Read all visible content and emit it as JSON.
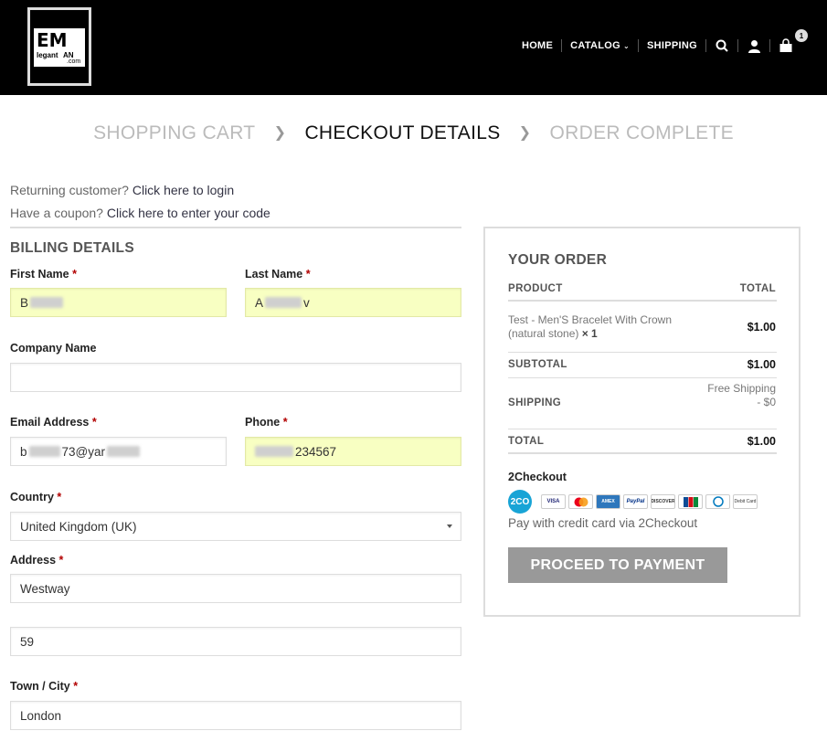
{
  "header": {
    "logo": {
      "big": "EM",
      "small_left": "legant",
      "small_right": "AN",
      "small_sub": ".com"
    },
    "nav": [
      {
        "label": "HOME"
      },
      {
        "label": "CATALOG"
      },
      {
        "label": "SHIPPING"
      }
    ],
    "cart_count": "1"
  },
  "steps": {
    "cart": "SHOPPING CART",
    "checkout": "CHECKOUT DETAILS",
    "complete": "ORDER COMPLETE"
  },
  "notices": {
    "login_prefix": "Returning customer?",
    "login_link": "Click here to login",
    "coupon_prefix": "Have a coupon?",
    "coupon_link": "Click here to enter your code"
  },
  "billing": {
    "title": "BILLING DETAILS",
    "first_name": {
      "label": "First Name",
      "value_start": "B"
    },
    "last_name": {
      "label": "Last Name",
      "value_start": "A",
      "value_end": "v"
    },
    "company": {
      "label": "Company Name",
      "value": ""
    },
    "email": {
      "label": "Email Address",
      "value_start": "b",
      "value_mid": "73@yar"
    },
    "phone": {
      "label": "Phone",
      "value_end": "234567"
    },
    "country": {
      "label": "Country",
      "value": "United Kingdom (UK)"
    },
    "address": {
      "label": "Address",
      "line1": "Westway",
      "line2": "59"
    },
    "city": {
      "label": "Town / City",
      "value": "London"
    },
    "required_mark": "*"
  },
  "order": {
    "title": "YOUR ORDER",
    "product_header": "PRODUCT",
    "total_header": "TOTAL",
    "product_name": "Test - Men'S Bracelet With Crown (natural stone)",
    "product_qty": "× 1",
    "product_total": "$1.00",
    "subtotal_label": "SUBTOTAL",
    "subtotal_value": "$1.00",
    "shipping_label": "SHIPPING",
    "shipping_value": "Free Shipping - $0",
    "total_label": "TOTAL",
    "total_value": "$1.00",
    "payment_method": "2Checkout",
    "payment_logo": "2CO",
    "cards": [
      "VISA",
      "MC",
      "AMEX",
      "PayPal",
      "DISCOVER",
      "JCB",
      "Diners",
      "Debit Card"
    ],
    "payment_desc": "Pay with credit card via 2Checkout",
    "proceed_label": "PROCEED TO PAYMENT"
  }
}
